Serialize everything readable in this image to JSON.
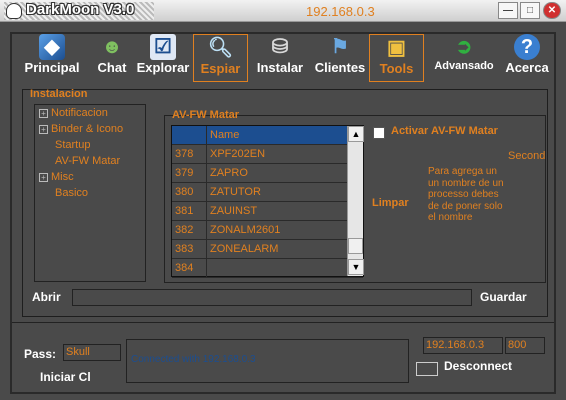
{
  "window": {
    "title": "DarkMoon V3.0",
    "ip": "192.168.0.3",
    "btn_min": "—",
    "btn_max": "□",
    "btn_close": "✕"
  },
  "toolbar": [
    {
      "label": "Principal",
      "icon": "cube-icon"
    },
    {
      "label": "Chat",
      "icon": "users-icon"
    },
    {
      "label": "Explorar",
      "icon": "checklist-icon"
    },
    {
      "label": "Espiar",
      "icon": "magnifier-icon",
      "active": true
    },
    {
      "label": "Instalar",
      "icon": "install-icon"
    },
    {
      "label": "Clientes",
      "icon": "network-icon"
    },
    {
      "label": "Tools",
      "icon": "tools-icon",
      "active": true
    },
    {
      "label": "Advansado",
      "icon": "green-arrow-icon"
    },
    {
      "label": "Acerca",
      "icon": "help-icon"
    }
  ],
  "section": {
    "title": "Instalacion"
  },
  "tree": [
    {
      "label": "Notificacion",
      "expand": "+"
    },
    {
      "label": "Binder & Icono",
      "expand": "+"
    },
    {
      "label": "Startup",
      "expand": ""
    },
    {
      "label": "AV-FW Matar",
      "expand": ""
    },
    {
      "label": "Misc",
      "expand": "+"
    },
    {
      "label": "Basico",
      "expand": ""
    }
  ],
  "avfw": {
    "title": "AV-FW Matar",
    "header": {
      "c1": "",
      "c2": "Name"
    },
    "rows": [
      {
        "id": "378",
        "name": "XPF202EN"
      },
      {
        "id": "379",
        "name": "ZAPRO"
      },
      {
        "id": "380",
        "name": "ZATUTOR"
      },
      {
        "id": "381",
        "name": "ZAUINST"
      },
      {
        "id": "382",
        "name": "ZONALM2601"
      },
      {
        "id": "383",
        "name": "ZONEALARM"
      },
      {
        "id": "384",
        "name": ""
      }
    ],
    "activate_label": "Activar AV-FW Matar",
    "second_label": "Second",
    "limpar_label": "Limpar",
    "description": "Para agrega un un nombre de un processo debes de de poner solo el nombre"
  },
  "file": {
    "open_label": "Abrir",
    "path_value": "",
    "save_label": "Guardar"
  },
  "connection": {
    "pass_label": "Pass:",
    "pass_value": "Skull",
    "start_label": "Iniciar Cl",
    "status_text": "Connected with 192.168.0.3",
    "ip_value": "192.168.0.3",
    "port_value": "800",
    "disconnect_label": "Desconnect"
  },
  "colors": {
    "accent": "#e08020",
    "selection": "#1c4e90",
    "background": "#4a4a4a"
  }
}
